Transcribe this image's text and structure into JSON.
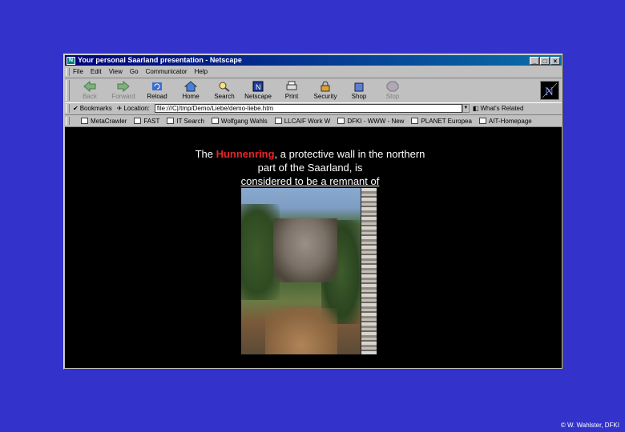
{
  "window": {
    "title": "Your personal Saarland presentation - Netscape",
    "controls": [
      "_",
      "□",
      "×"
    ]
  },
  "menu": [
    "File",
    "Edit",
    "View",
    "Go",
    "Communicator",
    "Help"
  ],
  "toolbar": {
    "buttons": [
      {
        "label": "Back",
        "icon": "back-arrow-icon",
        "disabled": true
      },
      {
        "label": "Forward",
        "icon": "forward-arrow-icon",
        "disabled": true
      },
      {
        "label": "Reload",
        "icon": "reload-icon",
        "disabled": false
      },
      {
        "label": "Home",
        "icon": "home-icon",
        "disabled": false
      },
      {
        "label": "Search",
        "icon": "search-icon",
        "disabled": false
      },
      {
        "label": "Netscape",
        "icon": "netscape-icon",
        "disabled": false
      },
      {
        "label": "Print",
        "icon": "print-icon",
        "disabled": false
      },
      {
        "label": "Security",
        "icon": "lock-icon",
        "disabled": false
      },
      {
        "label": "Shop",
        "icon": "shop-icon",
        "disabled": false
      },
      {
        "label": "Stop",
        "icon": "stop-icon",
        "disabled": true
      }
    ]
  },
  "location": {
    "bookmarks_label": "Bookmarks",
    "location_label": "Location:",
    "url": "file:///C|/tmp/Demo/Liebe/demo-liebe.htm",
    "whats_related": "What's Related"
  },
  "personal_toolbar": [
    "MetaCrawler",
    "FAST",
    "IT Search",
    "Wolfgang Wahls",
    "LLCAIF Work W",
    "DFKI - WWW - New",
    "PLANET Europea",
    "AIT-Homepage"
  ],
  "content": {
    "caption_pre": "The",
    "caption_highlight": "Hunnenring",
    "caption_mid": ", a protective  wall in the northern part of the Saarland, is",
    "caption_underlined": "considered to be a remnant of",
    "photo_alt": "Hunnenring rock wall photo"
  },
  "footer": {
    "copyright": "© W. Wahlster, DFKI"
  },
  "colors": {
    "background": "#3333cc",
    "highlight": "#e8242a",
    "titlebar": "#00007b"
  }
}
